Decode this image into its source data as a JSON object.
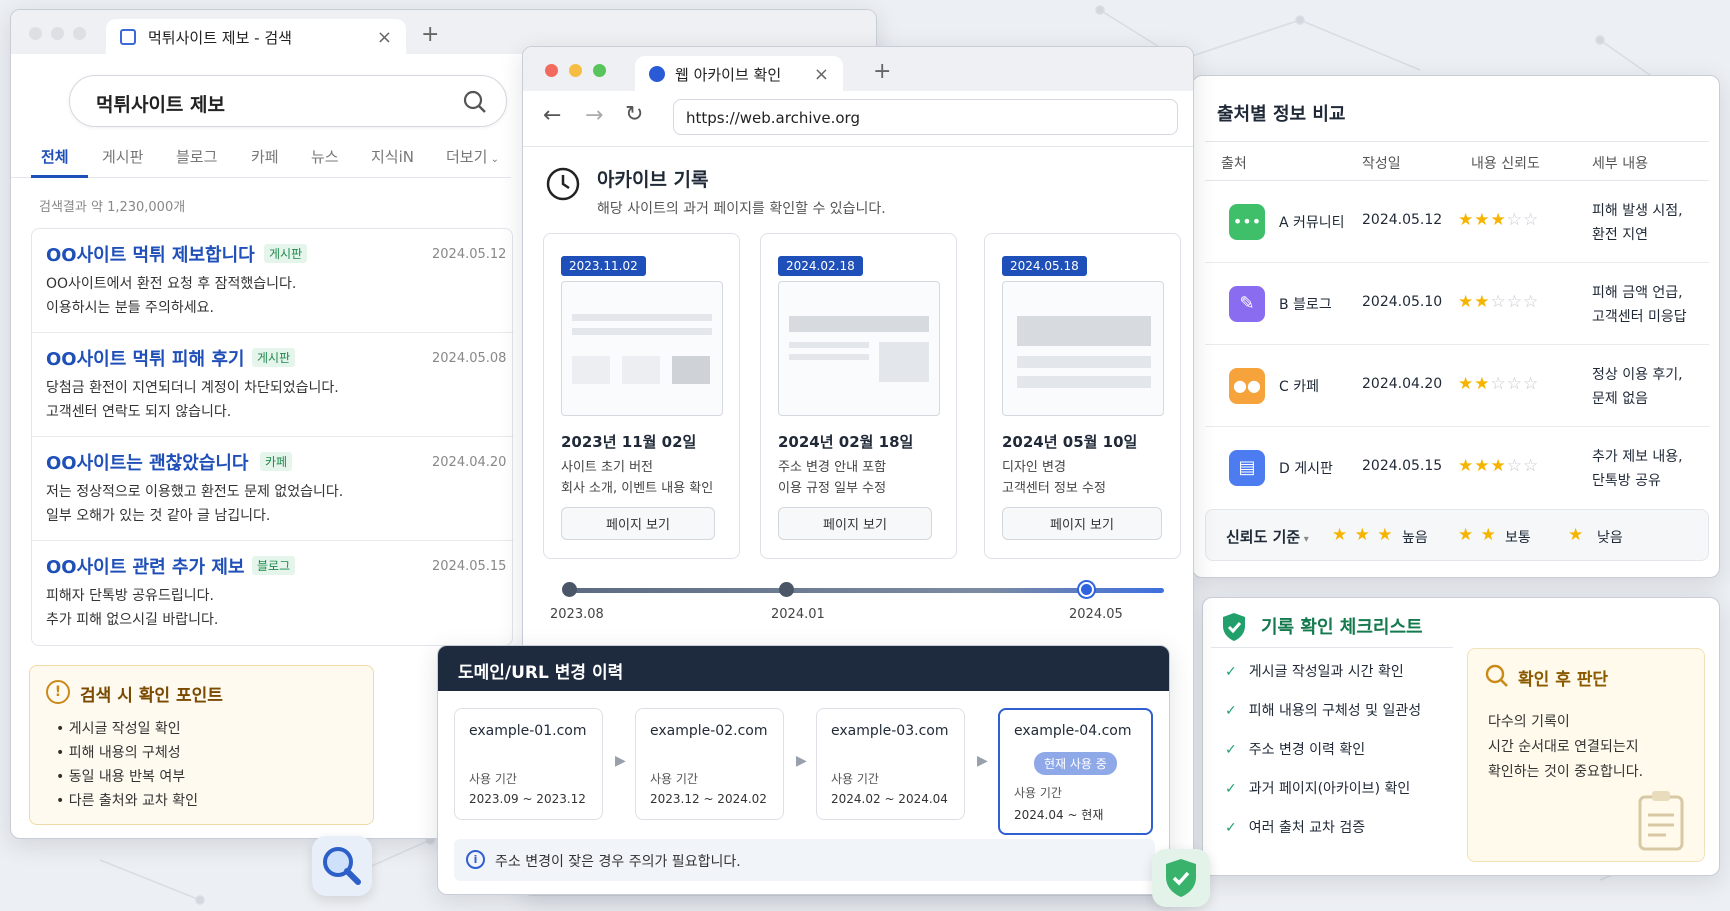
{
  "search_window": {
    "tab_title": "먹튀사이트 제보 - 검색",
    "query": "먹튀사이트 제보",
    "tabs": [
      "전체",
      "게시판",
      "블로그",
      "카페",
      "뉴스",
      "지식iN",
      "더보기"
    ],
    "result_count": "검색결과 약 1,230,000개",
    "results": [
      {
        "title": "OO사이트 먹튀 제보합니다",
        "badge": "게시판",
        "date": "2024.05.12",
        "line1": "OO사이트에서 환전 요청 후 잠적했습니다.",
        "line2": "이용하시는 분들 주의하세요."
      },
      {
        "title": "OO사이트 먹튀 피해 후기",
        "badge": "게시판",
        "date": "2024.05.08",
        "line1": "당첨금 환전이 지연되더니 계정이 차단되었습니다.",
        "line2": "고객센터 연락도 되지 않습니다."
      },
      {
        "title": "OO사이트는 괜찮았습니다",
        "badge": "카페",
        "date": "2024.04.20",
        "line1": "저는 정상적으로 이용했고 환전도 문제 없었습니다.",
        "line2": "일부 오해가 있는 것 같아 글 남깁니다."
      },
      {
        "title": "OO사이트 관련 추가 제보",
        "badge": "블로그",
        "date": "2024.05.15",
        "line1": "피해자 단톡방 공유드립니다.",
        "line2": "추가 피해 없으시길 바랍니다."
      }
    ],
    "tip_box": {
      "title": "검색 시 확인 포인트",
      "items": [
        "게시글 작성일 확인",
        "피해 내용의 구체성",
        "동일 내용 반복 여부",
        "다른 출처와 교차 확인"
      ]
    }
  },
  "archive_window": {
    "tab_title": "웹 아카이브 확인",
    "url": "https://web.archive.org",
    "heading": "아카이브 기록",
    "subheading": "해당 사이트의 과거 페이지를 확인할 수 있습니다.",
    "snapshots": [
      {
        "tag": "2023.11.02",
        "date": "2023년 11월 02일",
        "desc1": "사이트 초기 버전",
        "desc2": "회사 소개, 이벤트 내용 확인",
        "button": "페이지 보기"
      },
      {
        "tag": "2024.02.18",
        "date": "2024년 02월 18일",
        "desc1": "주소 변경 안내 포함",
        "desc2": "이용 규정 일부 수정",
        "button": "페이지 보기"
      },
      {
        "tag": "2024.05.18",
        "date": "2024년 05월 10일",
        "desc1": "디자인 변경",
        "desc2": "고객센터 정보 수정",
        "button": "페이지 보기"
      }
    ],
    "timeline": [
      "2023.08",
      "2024.01",
      "2024.05"
    ]
  },
  "domain_panel": {
    "title": "도메인/URL 변경 이력",
    "period_label": "사용 기간",
    "current_badge": "현재 사용 중",
    "domains": [
      {
        "name": "example-01.com",
        "period": "2023.09 ~ 2023.12"
      },
      {
        "name": "example-02.com",
        "period": "2023.12 ~ 2024.02"
      },
      {
        "name": "example-03.com",
        "period": "2024.02 ~ 2024.04"
      },
      {
        "name": "example-04.com",
        "period": "2024.04 ~ 현재"
      }
    ],
    "notice": "주소 변경이 잦은 경우 주의가 필요합니다."
  },
  "compare_panel": {
    "title": "출처별 정보 비교",
    "headers": [
      "출처",
      "작성일",
      "내용 신뢰도",
      "세부 내용"
    ],
    "rows": [
      {
        "source": "A 커뮤니티",
        "date": "2024.05.12",
        "rating": 3,
        "d1": "피해 발생 시점,",
        "d2": "환전 지연",
        "icon_color": "#3fbf6a",
        "icon": "chat-icon"
      },
      {
        "source": "B 블로그",
        "date": "2024.05.10",
        "rating": 2,
        "d1": "피해 금액 언급,",
        "d2": "고객센터 미응답",
        "icon_color": "#8a6cf0",
        "icon": "pencil-icon"
      },
      {
        "source": "C 카페",
        "date": "2024.04.20",
        "rating": 2,
        "d1": "정상 이용 후기,",
        "d2": "문제 없음",
        "icon_color": "#f5a33a",
        "icon": "people-icon"
      },
      {
        "source": "D 게시판",
        "date": "2024.05.15",
        "rating": 3,
        "d1": "추가 제보 내용,",
        "d2": "단톡방 공유",
        "icon_color": "#4d7cf0",
        "icon": "document-icon"
      }
    ],
    "legend": {
      "label": "신뢰도 기준",
      "high": "높음",
      "mid": "보통",
      "low": "낮음"
    }
  },
  "checklist_panel": {
    "title": "기록 확인 체크리스트",
    "items": [
      "게시글 작성일과 시간 확인",
      "피해 내용의 구체성 및 일관성",
      "주소 변경 이력 확인",
      "과거 페이지(아카이브) 확인",
      "여러 출처 교차 검증"
    ],
    "judge_title": "확인 후 판단",
    "judge_lines": [
      "다수의 기록이",
      "시간 순서대로 연결되는지",
      "확인하는 것이 중요합니다."
    ]
  }
}
